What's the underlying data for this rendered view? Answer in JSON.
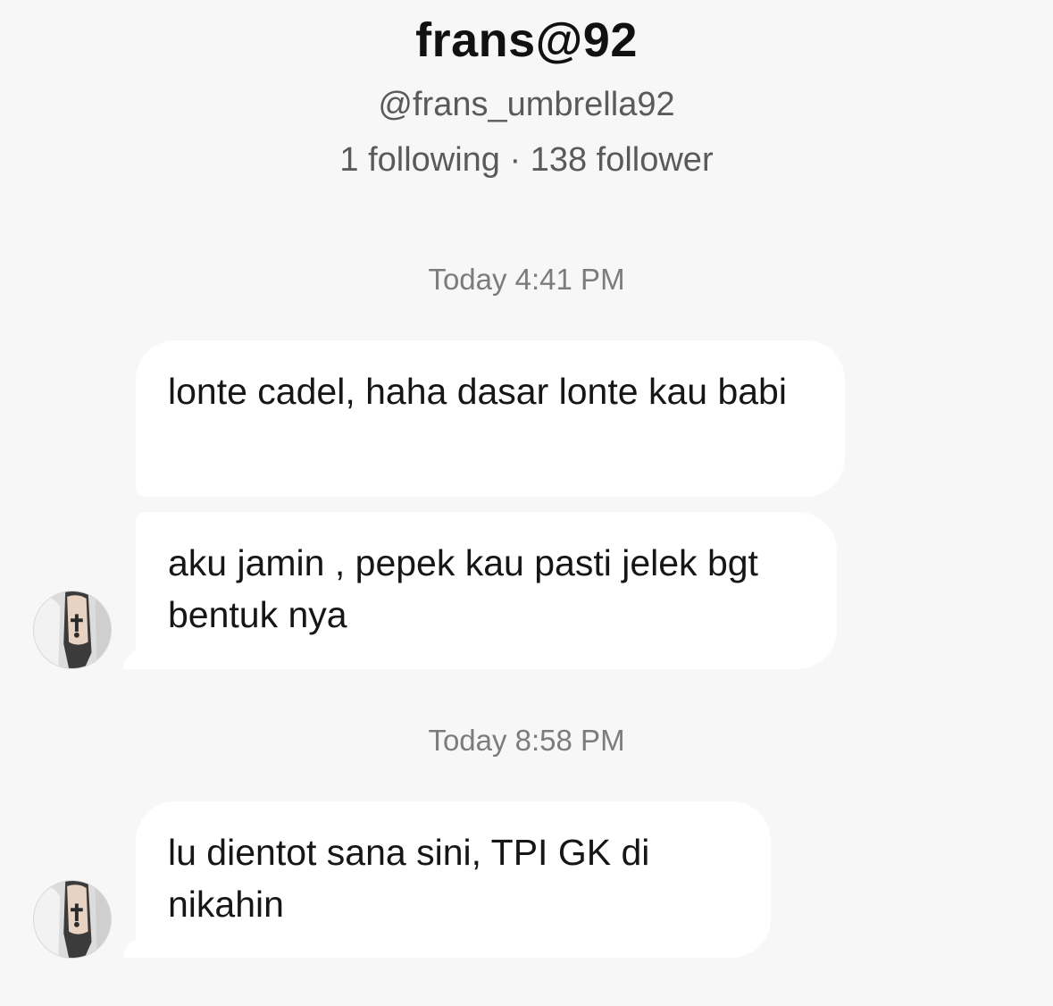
{
  "profile": {
    "name": "frans@92",
    "handle": "@frans_umbrella92",
    "stats": "1 following · 138 follower"
  },
  "conversation": {
    "groups": [
      {
        "timestamp": "Today 4:41 PM",
        "messages": [
          {
            "text": "lonte cadel, haha dasar lonte kau babi"
          },
          {
            "text": "aku jamin , pepek kau pasti jelek bgt bentuk nya"
          }
        ]
      },
      {
        "timestamp": "Today 8:58 PM",
        "messages": [
          {
            "text": "lu dientot sana sini, TPI GK di nikahin"
          }
        ]
      }
    ]
  },
  "colors": {
    "background": "#f7f7f7",
    "bubble": "#ffffff",
    "primary_text": "#111111",
    "secondary_text": "#5a5a5a",
    "timestamp_text": "#7c7c7c"
  },
  "icons": {
    "avatar": "user-avatar-photo"
  }
}
